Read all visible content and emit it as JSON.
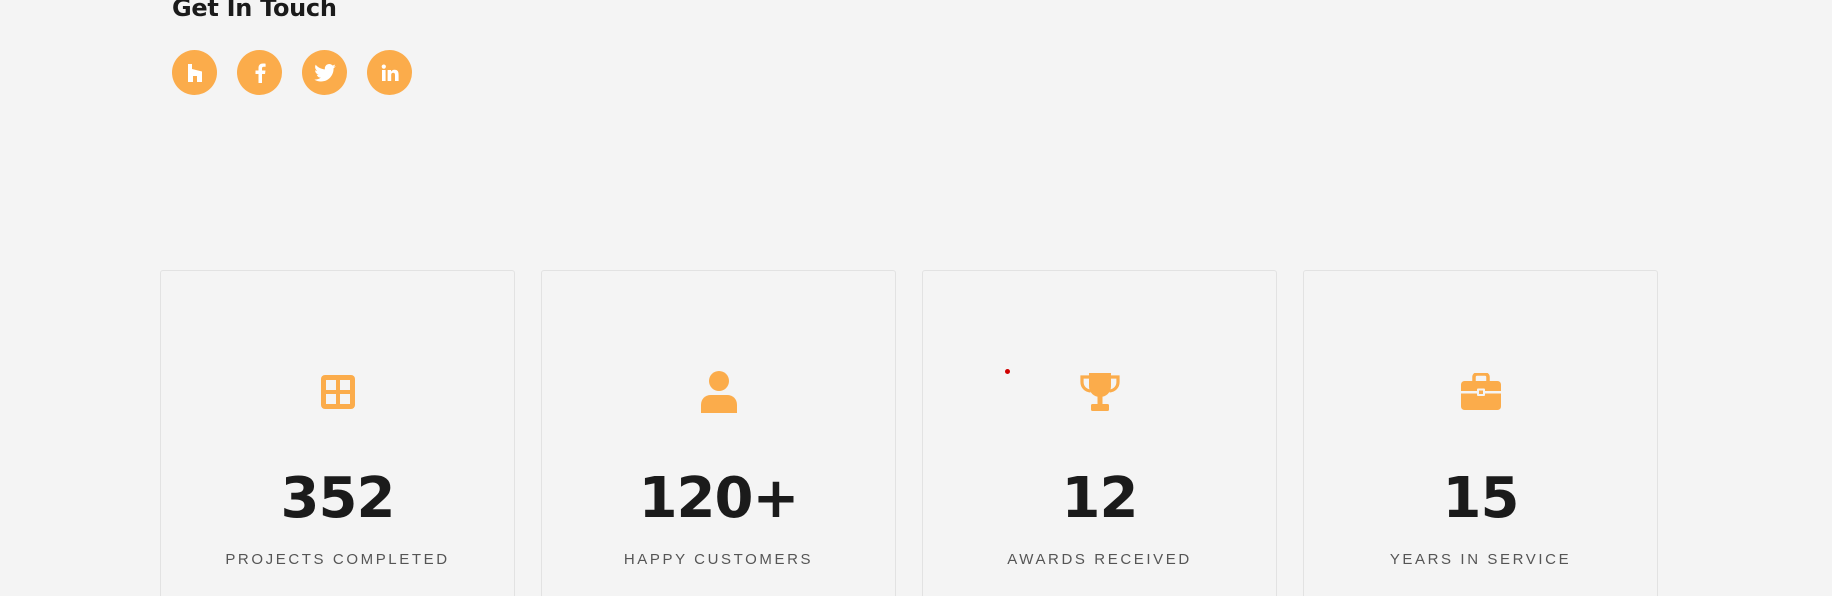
{
  "contact": {
    "heading": "Get In Touch",
    "social_links": [
      {
        "name": "houzz",
        "icon": "houzz-icon"
      },
      {
        "name": "facebook",
        "icon": "facebook-icon"
      },
      {
        "name": "twitter",
        "icon": "twitter-icon"
      },
      {
        "name": "linkedin",
        "icon": "linkedin-icon"
      }
    ]
  },
  "stats": [
    {
      "value": "352",
      "label": "PROJECTS COMPLETED",
      "icon": "grid-icon"
    },
    {
      "value": "120+",
      "label": "HAPPY CUSTOMERS",
      "icon": "user-icon"
    },
    {
      "value": "12",
      "label": "AWARDS RECEIVED",
      "icon": "trophy-icon"
    },
    {
      "value": "15",
      "label": "YEARS IN SERVICE",
      "icon": "briefcase-icon"
    }
  ],
  "colors": {
    "accent": "#fbac4b",
    "background": "#f4f4f4",
    "text_dark": "#1b1b1b",
    "text_label": "#555555",
    "card_border": "#e2e2e2"
  }
}
